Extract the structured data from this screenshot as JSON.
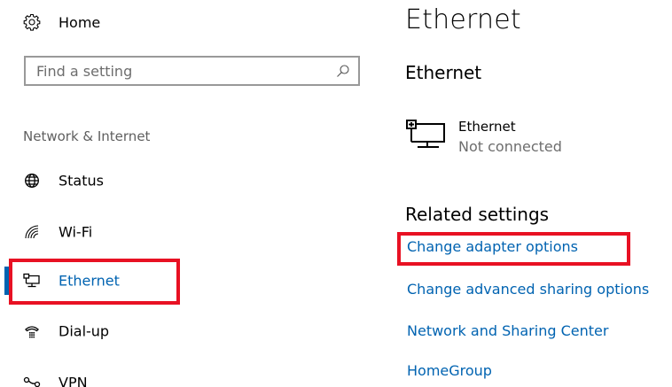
{
  "nav": {
    "home_label": "Home",
    "search": {
      "placeholder": "Find a setting",
      "value": ""
    },
    "section_title": "Network & Internet",
    "items": [
      {
        "id": "status",
        "label": "Status",
        "icon": "globe-icon"
      },
      {
        "id": "wifi",
        "label": "Wi-Fi",
        "icon": "wifi-icon"
      },
      {
        "id": "ethernet",
        "label": "Ethernet",
        "icon": "ethernet-icon",
        "selected": true
      },
      {
        "id": "dialup",
        "label": "Dial-up",
        "icon": "dialup-icon"
      },
      {
        "id": "vpn",
        "label": "VPN",
        "icon": "vpn-icon"
      }
    ]
  },
  "content": {
    "title": "Ethernet",
    "subtitle": "Ethernet",
    "connection": {
      "name": "Ethernet",
      "status": "Not connected",
      "icon": "ethernet-icon"
    },
    "related_title": "Related settings",
    "links": [
      "Change adapter options",
      "Change advanced sharing options",
      "Network and Sharing Center",
      "HomeGroup"
    ]
  },
  "colors": {
    "accent": "#0063b1",
    "highlight": "#e81123",
    "secondary_text": "#6d6d6d"
  }
}
